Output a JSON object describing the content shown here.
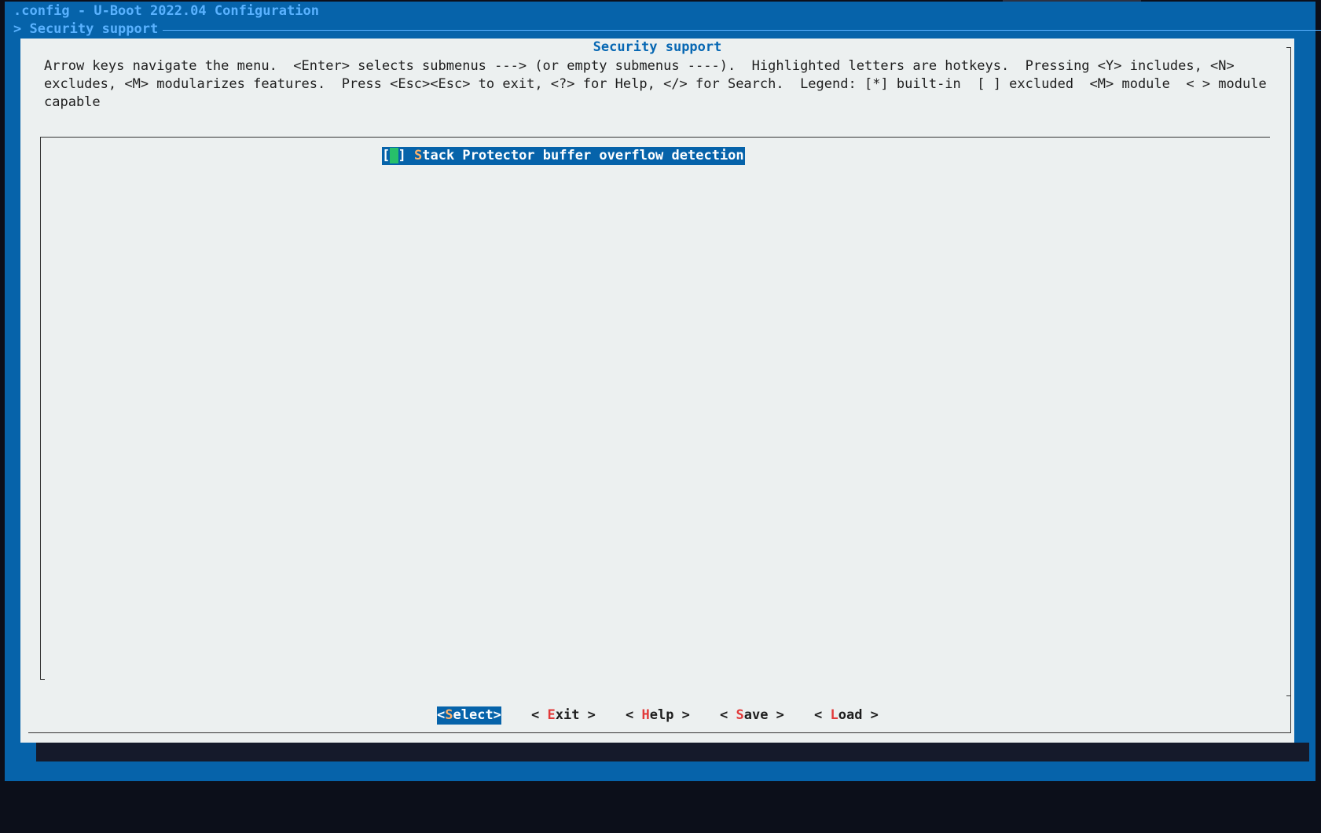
{
  "window": {
    "title": ".config - U-Boot 2022.04 Configuration",
    "breadcrumb": "> Security support"
  },
  "dialog": {
    "title": "Security support",
    "help_text": "Arrow keys navigate the menu.  <Enter> selects submenus ---> (or empty submenus ----).  Highlighted letters are hotkeys.  Pressing <Y> includes, <N> excludes, <M> modularizes features.  Press <Esc><Esc> to exit, <?> for Help, </> for Search.  Legend: [*] built-in  [ ] excluded  <M> module  < > module capable"
  },
  "menu": {
    "items": [
      {
        "checkbox_open": "[",
        "checkbox_close": "]",
        "hotkey": "S",
        "label_rest": "tack Protector buffer overflow detection",
        "selected": true
      }
    ]
  },
  "buttons": {
    "select": {
      "pre": "<",
      "hot": "S",
      "rest": "elect>",
      "active": true
    },
    "exit": {
      "pre": "< ",
      "hot": "E",
      "rest": "xit >"
    },
    "help": {
      "pre": "< ",
      "hot": "H",
      "rest": "elp >"
    },
    "save": {
      "pre": "< ",
      "hot": "S",
      "rest": "ave >"
    },
    "load": {
      "pre": "< ",
      "hot": "L",
      "rest": "oad >"
    }
  },
  "colors": {
    "background_blue": "#0663aa",
    "dialog_bg": "#ecf0f0",
    "highlight_text": "#ffffff",
    "hotkey_selected": "#ffb26b",
    "hotkey_button": "#e23a3a",
    "cursor_green": "#27c06a",
    "title_blue": "#0667b3"
  }
}
